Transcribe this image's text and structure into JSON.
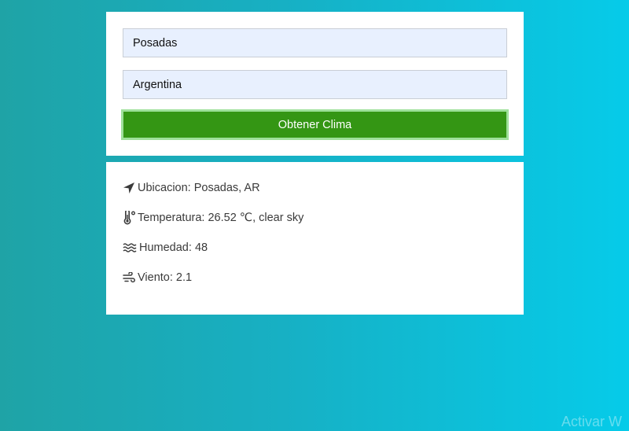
{
  "form": {
    "city_value": "Posadas",
    "country_value": "Argentina",
    "submit_label": "Obtener Clima"
  },
  "results": {
    "location": {
      "icon": "location-arrow-icon",
      "label": "Ubicacion:",
      "value": "Posadas, AR"
    },
    "temperature": {
      "icon": "thermometer-icon",
      "label": "Temperatura:",
      "value": "26.52 ℃, clear sky"
    },
    "humidity": {
      "icon": "water-waves-icon",
      "label": "Humedad:",
      "value": "48"
    },
    "wind": {
      "icon": "wind-icon",
      "label": "Viento:",
      "value": "2.1"
    }
  },
  "watermark": {
    "text": "Activar W"
  },
  "colors": {
    "background_start": "#1fa3a6",
    "background_end": "#06cbe9",
    "button": "#349614",
    "button_border": "#9ee09a",
    "input_fill": "#e8f0fe"
  }
}
